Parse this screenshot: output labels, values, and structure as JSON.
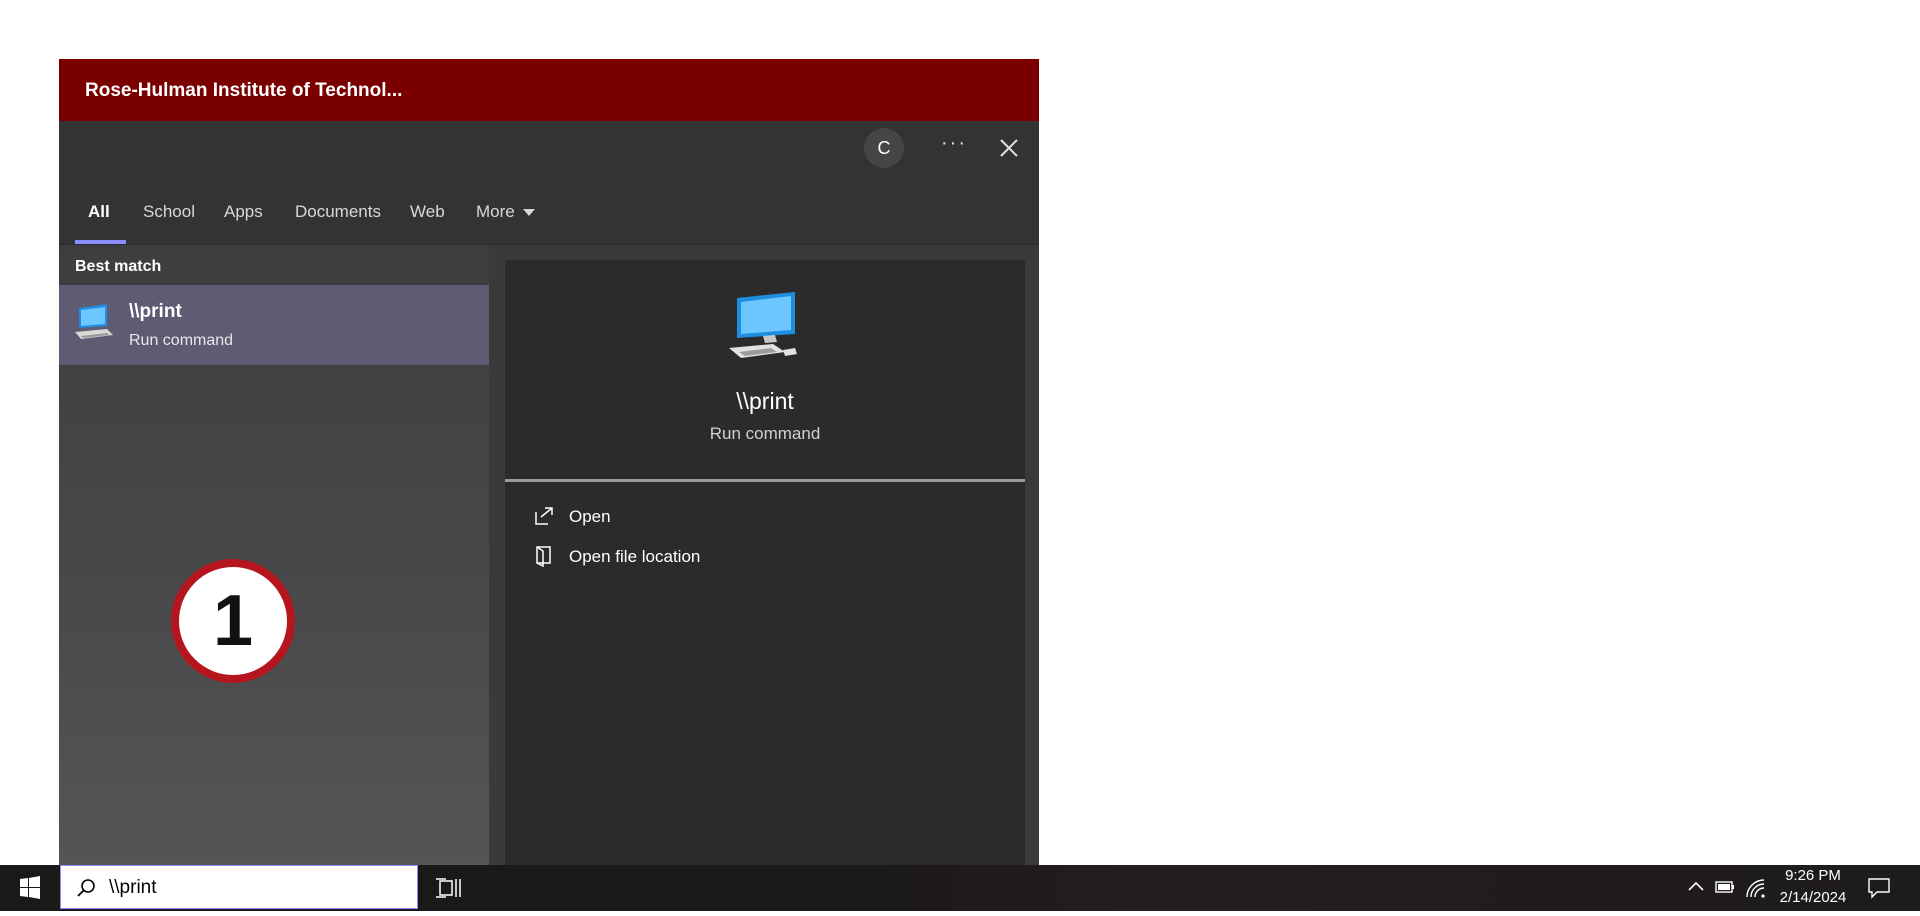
{
  "search_flyout": {
    "org_title": "Rose-Hulman Institute of Technol...",
    "tabs": [
      {
        "label": "All",
        "active": true
      },
      {
        "label": "School"
      },
      {
        "label": "Apps"
      },
      {
        "label": "Documents"
      },
      {
        "label": "Web"
      },
      {
        "label": "More"
      }
    ],
    "loading_glyph": "C",
    "more_options_glyph": "···",
    "best_match_label": "Best match",
    "best_match": {
      "name": "\\\\print",
      "type": "Run command"
    },
    "preview": {
      "name": "\\\\print",
      "type": "Run command"
    },
    "actions": [
      {
        "label": "Open",
        "icon": "open-external-icon"
      },
      {
        "label": "Open file location",
        "icon": "file-location-icon"
      }
    ]
  },
  "annotation": {
    "step_number": "1"
  },
  "taskbar": {
    "search_value": "\\\\print",
    "time": "9:26 PM",
    "date": "2/14/2024"
  },
  "colors": {
    "org_bar": "#7a0000",
    "selected_result": "#5e5b73",
    "tab_accent": "#8b8dff",
    "step_badge_ring": "#b5161e"
  }
}
